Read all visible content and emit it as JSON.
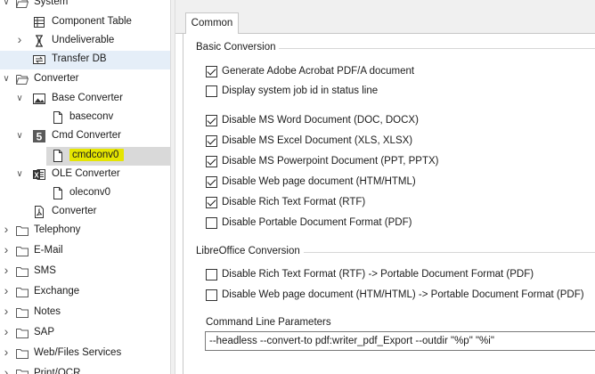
{
  "tree": {
    "items": [
      {
        "label": "System",
        "icon": "folder-open-icon",
        "expanded": true
      },
      {
        "label": "Component Table",
        "icon": "table-grid-icon"
      },
      {
        "label": "Undeliverable",
        "icon": "undeliverable-icon",
        "expanded": false
      },
      {
        "label": "Transfer DB",
        "icon": "transfer-db-icon",
        "selected": true
      },
      {
        "label": "Converter",
        "icon": "folder-open-icon",
        "expanded": true
      },
      {
        "label": "Base Converter",
        "icon": "image-icon",
        "expanded": true
      },
      {
        "label": "baseconv",
        "icon": "document-icon"
      },
      {
        "label": "Cmd Converter",
        "icon": "number-five-icon",
        "expanded": true
      },
      {
        "label": "cmdconv0",
        "icon": "document-icon",
        "highlighted": true
      },
      {
        "label": "OLE Converter",
        "icon": "excel-icon",
        "expanded": true
      },
      {
        "label": "oleconv0",
        "icon": "document-icon"
      },
      {
        "label": "Converter",
        "icon": "pdf-document-icon"
      },
      {
        "label": "Telephony",
        "icon": "folder-icon",
        "expanded": false
      },
      {
        "label": "E-Mail",
        "icon": "folder-icon",
        "expanded": false
      },
      {
        "label": "SMS",
        "icon": "folder-icon",
        "expanded": false
      },
      {
        "label": "Exchange",
        "icon": "folder-icon",
        "expanded": false
      },
      {
        "label": "Notes",
        "icon": "folder-icon",
        "expanded": false
      },
      {
        "label": "SAP",
        "icon": "folder-icon",
        "expanded": false
      },
      {
        "label": "Web/Files Services",
        "icon": "folder-icon",
        "expanded": false
      },
      {
        "label": "Print/OCR",
        "icon": "folder-icon",
        "expanded": false
      }
    ]
  },
  "tabs": [
    {
      "label": "Common",
      "active": true
    }
  ],
  "basic": {
    "title": "Basic Conversion",
    "options": [
      {
        "label": "Generate Adobe Acrobat PDF/A document",
        "checked": true
      },
      {
        "label": "Display system job id in status line",
        "checked": false
      },
      {
        "label": "Disable MS Word Document (DOC, DOCX)",
        "checked": true
      },
      {
        "label": "Disable MS Excel Document (XLS, XLSX)",
        "checked": true
      },
      {
        "label": "Disable MS Powerpoint Document (PPT, PPTX)",
        "checked": true
      },
      {
        "label": "Disable Web page document (HTM/HTML)",
        "checked": true
      },
      {
        "label": "Disable Rich Text Format (RTF)",
        "checked": true
      },
      {
        "label": "Disable Portable Document Format (PDF)",
        "checked": false
      }
    ]
  },
  "libre": {
    "title": "LibreOffice Conversion",
    "options": [
      {
        "label": "Disable Rich Text Format (RTF) -> Portable Document Format (PDF)",
        "checked": false
      },
      {
        "label": "Disable Web page document (HTM/HTML) ->  Portable Document Format (PDF)",
        "checked": false
      }
    ]
  },
  "command": {
    "label": "Command Line Parameters",
    "value": "--headless --convert-to pdf:writer_pdf_Export --outdir \"%p\" \"%i\""
  },
  "colors": {
    "highlight": "#e5e500",
    "selection_blue": "#e5eef8",
    "selection_grey": "#d9d9d9",
    "folder": "#7a6a2a"
  }
}
